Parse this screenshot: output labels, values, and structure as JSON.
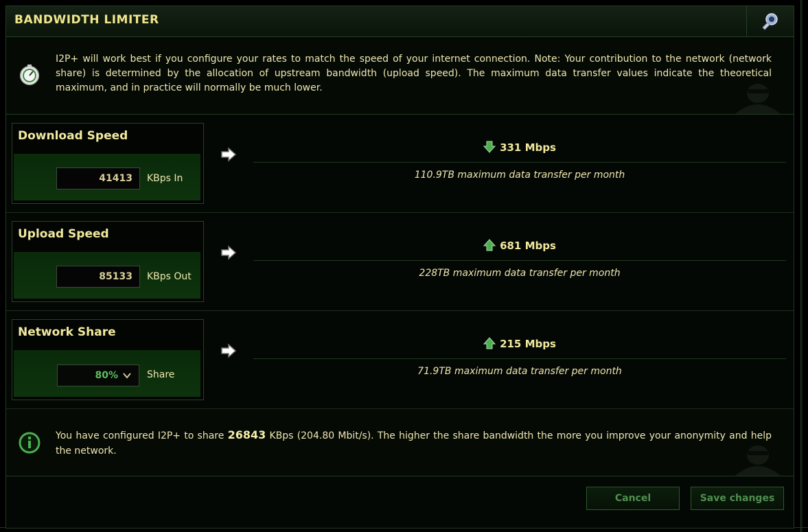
{
  "header": {
    "title": "BANDWIDTH LIMITER"
  },
  "intro": {
    "text": "I2P+ will work best if you configure your rates to match the speed of your internet connection.  Note: Your contribution to the network (network share) is determined by the allocation of upstream bandwidth (upload speed).  The maximum data transfer values indicate the theoretical maximum, and in practice will normally be much lower."
  },
  "download": {
    "title": "Download Speed",
    "value": "41413",
    "unit": "KBps In",
    "speed": "331 Mbps",
    "transfer": "110.9TB maximum data transfer per month"
  },
  "upload": {
    "title": "Upload Speed",
    "value": "85133",
    "unit": "KBps Out",
    "speed": "681 Mbps",
    "transfer": "228TB maximum data transfer per month"
  },
  "share": {
    "title": "Network Share",
    "value": "80%",
    "unit": "Share",
    "speed": "215 Mbps",
    "transfer": "71.9TB maximum data transfer per month"
  },
  "info": {
    "prefix": "You have configured I2P+ to share ",
    "amount": "26843",
    "suffix": " KBps (204.80 Mbit/s). The higher the share bandwidth the more you improve your anonymity and help the network."
  },
  "buttons": {
    "cancel": "Cancel",
    "save": "Save changes"
  },
  "colors": {
    "accent": "#f0e68c",
    "panel": "#0d330d",
    "border": "#2c5a2c",
    "arrow_green": "#4caf50"
  }
}
